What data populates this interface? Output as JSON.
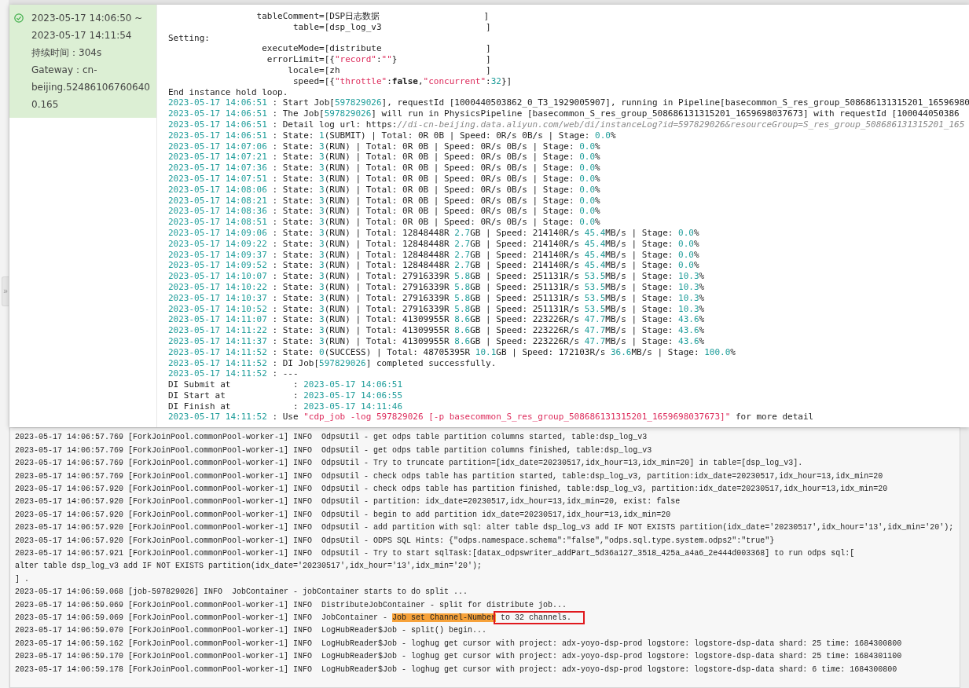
{
  "sidebar_toggle": "»",
  "run_card": {
    "succeeded": true,
    "time_range": "2023-05-17 14:06:50 ~ 2023-05-17 14:11:54",
    "duration": "持续时间：304s",
    "gateway": "Gateway：cn-beijing.524861067606400.165"
  },
  "run_log": [
    {
      "segments": [
        {
          "kind": "plain",
          "text": "                 tableComment=[DSP日志数据                    ]"
        }
      ]
    },
    {
      "segments": [
        {
          "kind": "plain",
          "text": "                        table=[dsp_log_v3                    ]"
        }
      ]
    },
    {
      "segments": [
        {
          "kind": "plain",
          "text": "Setting:"
        }
      ]
    },
    {
      "segments": [
        {
          "kind": "plain",
          "text": "                  executeMode=[distribute                    ]"
        }
      ]
    },
    {
      "segments": [
        {
          "kind": "plain",
          "text": "                   errorLimit=[{"
        },
        {
          "kind": "string",
          "text": "\"record\""
        },
        {
          "kind": "plain",
          "text": ":"
        },
        {
          "kind": "string",
          "text": "\"\""
        },
        {
          "kind": "plain",
          "text": "}                 ]"
        }
      ]
    },
    {
      "segments": [
        {
          "kind": "plain",
          "text": "                       locale=[zh                            ]"
        }
      ]
    },
    {
      "segments": [
        {
          "kind": "plain",
          "text": "                        speed=[{"
        },
        {
          "kind": "string",
          "text": "\"throttle\""
        },
        {
          "kind": "plain",
          "text": ":"
        },
        {
          "kind": "bold",
          "text": "false"
        },
        {
          "kind": "plain",
          "text": ","
        },
        {
          "kind": "string",
          "text": "\"concurrent\""
        },
        {
          "kind": "plain",
          "text": ":"
        },
        {
          "kind": "number",
          "text": "32"
        },
        {
          "kind": "plain",
          "text": "}]"
        }
      ]
    },
    {
      "segments": [
        {
          "kind": "plain",
          "text": "End instance hold loop."
        }
      ]
    },
    {
      "segments": [
        {
          "kind": "number",
          "text": "2023-05-17 14:06:51"
        },
        {
          "kind": "plain",
          "text": " : Start Job["
        },
        {
          "kind": "number",
          "text": "597829026"
        },
        {
          "kind": "plain",
          "text": "], requestId [1000440503862_0_T3_1929005907], running in Pipeline[basecommon_S_res_group_508686131315201_16596980"
        }
      ]
    },
    {
      "segments": [
        {
          "kind": "number",
          "text": "2023-05-17 14:06:51"
        },
        {
          "kind": "plain",
          "text": " : The Job["
        },
        {
          "kind": "number",
          "text": "597829026"
        },
        {
          "kind": "plain",
          "text": "] will run in PhysicsPipeline [basecommon_S_res_group_508686131315201_1659698037673] with requestId [100044050386"
        }
      ]
    },
    {
      "segments": [
        {
          "kind": "number",
          "text": "2023-05-17 14:06:51"
        },
        {
          "kind": "plain",
          "text": " : Detail log url: https:"
        },
        {
          "kind": "link",
          "text": "//di-cn-beijing.data.aliyun.com/web/di/instanceLog?id=597829026&resourceGroup=S_res_group_508686131315201_165"
        }
      ]
    },
    {
      "segments": [
        {
          "kind": "number",
          "text": "2023-05-17 14:06:51"
        },
        {
          "kind": "plain",
          "text": " : State: "
        },
        {
          "kind": "number",
          "text": "1"
        },
        {
          "kind": "plain",
          "text": "(SUBMIT) | Total: 0R 0B | Speed: 0R/s 0B/s | Stage: "
        },
        {
          "kind": "number",
          "text": "0.0"
        },
        {
          "kind": "plain",
          "text": "%"
        }
      ]
    },
    {
      "segments": [
        {
          "kind": "number",
          "text": "2023-05-17 14:07:06"
        },
        {
          "kind": "plain",
          "text": " : State: "
        },
        {
          "kind": "number",
          "text": "3"
        },
        {
          "kind": "plain",
          "text": "(RUN) | Total: 0R 0B | Speed: 0R/s 0B/s | Stage: "
        },
        {
          "kind": "number",
          "text": "0.0"
        },
        {
          "kind": "plain",
          "text": "%"
        }
      ]
    },
    {
      "segments": [
        {
          "kind": "number",
          "text": "2023-05-17 14:07:21"
        },
        {
          "kind": "plain",
          "text": " : State: "
        },
        {
          "kind": "number",
          "text": "3"
        },
        {
          "kind": "plain",
          "text": "(RUN) | Total: 0R 0B | Speed: 0R/s 0B/s | Stage: "
        },
        {
          "kind": "number",
          "text": "0.0"
        },
        {
          "kind": "plain",
          "text": "%"
        }
      ]
    },
    {
      "segments": [
        {
          "kind": "number",
          "text": "2023-05-17 14:07:36"
        },
        {
          "kind": "plain",
          "text": " : State: "
        },
        {
          "kind": "number",
          "text": "3"
        },
        {
          "kind": "plain",
          "text": "(RUN) | Total: 0R 0B | Speed: 0R/s 0B/s | Stage: "
        },
        {
          "kind": "number",
          "text": "0.0"
        },
        {
          "kind": "plain",
          "text": "%"
        }
      ]
    },
    {
      "segments": [
        {
          "kind": "number",
          "text": "2023-05-17 14:07:51"
        },
        {
          "kind": "plain",
          "text": " : State: "
        },
        {
          "kind": "number",
          "text": "3"
        },
        {
          "kind": "plain",
          "text": "(RUN) | Total: 0R 0B | Speed: 0R/s 0B/s | Stage: "
        },
        {
          "kind": "number",
          "text": "0.0"
        },
        {
          "kind": "plain",
          "text": "%"
        }
      ]
    },
    {
      "segments": [
        {
          "kind": "number",
          "text": "2023-05-17 14:08:06"
        },
        {
          "kind": "plain",
          "text": " : State: "
        },
        {
          "kind": "number",
          "text": "3"
        },
        {
          "kind": "plain",
          "text": "(RUN) | Total: 0R 0B | Speed: 0R/s 0B/s | Stage: "
        },
        {
          "kind": "number",
          "text": "0.0"
        },
        {
          "kind": "plain",
          "text": "%"
        }
      ]
    },
    {
      "segments": [
        {
          "kind": "number",
          "text": "2023-05-17 14:08:21"
        },
        {
          "kind": "plain",
          "text": " : State: "
        },
        {
          "kind": "number",
          "text": "3"
        },
        {
          "kind": "plain",
          "text": "(RUN) | Total: 0R 0B | Speed: 0R/s 0B/s | Stage: "
        },
        {
          "kind": "number",
          "text": "0.0"
        },
        {
          "kind": "plain",
          "text": "%"
        }
      ]
    },
    {
      "segments": [
        {
          "kind": "number",
          "text": "2023-05-17 14:08:36"
        },
        {
          "kind": "plain",
          "text": " : State: "
        },
        {
          "kind": "number",
          "text": "3"
        },
        {
          "kind": "plain",
          "text": "(RUN) | Total: 0R 0B | Speed: 0R/s 0B/s | Stage: "
        },
        {
          "kind": "number",
          "text": "0.0"
        },
        {
          "kind": "plain",
          "text": "%"
        }
      ]
    },
    {
      "segments": [
        {
          "kind": "number",
          "text": "2023-05-17 14:08:51"
        },
        {
          "kind": "plain",
          "text": " : State: "
        },
        {
          "kind": "number",
          "text": "3"
        },
        {
          "kind": "plain",
          "text": "(RUN) | Total: 0R 0B | Speed: 0R/s 0B/s | Stage: "
        },
        {
          "kind": "number",
          "text": "0.0"
        },
        {
          "kind": "plain",
          "text": "%"
        }
      ]
    },
    {
      "segments": [
        {
          "kind": "number",
          "text": "2023-05-17 14:09:06"
        },
        {
          "kind": "plain",
          "text": " : State: "
        },
        {
          "kind": "number",
          "text": "3"
        },
        {
          "kind": "plain",
          "text": "(RUN) | Total: 12848448R "
        },
        {
          "kind": "number",
          "text": "2.7"
        },
        {
          "kind": "plain",
          "text": "GB | Speed: 214140R/s "
        },
        {
          "kind": "number",
          "text": "45.4"
        },
        {
          "kind": "plain",
          "text": "MB/s | Stage: "
        },
        {
          "kind": "number",
          "text": "0.0"
        },
        {
          "kind": "plain",
          "text": "%"
        }
      ]
    },
    {
      "segments": [
        {
          "kind": "number",
          "text": "2023-05-17 14:09:22"
        },
        {
          "kind": "plain",
          "text": " : State: "
        },
        {
          "kind": "number",
          "text": "3"
        },
        {
          "kind": "plain",
          "text": "(RUN) | Total: 12848448R "
        },
        {
          "kind": "number",
          "text": "2.7"
        },
        {
          "kind": "plain",
          "text": "GB | Speed: 214140R/s "
        },
        {
          "kind": "number",
          "text": "45.4"
        },
        {
          "kind": "plain",
          "text": "MB/s | Stage: "
        },
        {
          "kind": "number",
          "text": "0.0"
        },
        {
          "kind": "plain",
          "text": "%"
        }
      ]
    },
    {
      "segments": [
        {
          "kind": "number",
          "text": "2023-05-17 14:09:37"
        },
        {
          "kind": "plain",
          "text": " : State: "
        },
        {
          "kind": "number",
          "text": "3"
        },
        {
          "kind": "plain",
          "text": "(RUN) | Total: 12848448R "
        },
        {
          "kind": "number",
          "text": "2.7"
        },
        {
          "kind": "plain",
          "text": "GB | Speed: 214140R/s "
        },
        {
          "kind": "number",
          "text": "45.4"
        },
        {
          "kind": "plain",
          "text": "MB/s | Stage: "
        },
        {
          "kind": "number",
          "text": "0.0"
        },
        {
          "kind": "plain",
          "text": "%"
        }
      ]
    },
    {
      "segments": [
        {
          "kind": "number",
          "text": "2023-05-17 14:09:52"
        },
        {
          "kind": "plain",
          "text": " : State: "
        },
        {
          "kind": "number",
          "text": "3"
        },
        {
          "kind": "plain",
          "text": "(RUN) | Total: 12848448R "
        },
        {
          "kind": "number",
          "text": "2.7"
        },
        {
          "kind": "plain",
          "text": "GB | Speed: 214140R/s "
        },
        {
          "kind": "number",
          "text": "45.4"
        },
        {
          "kind": "plain",
          "text": "MB/s | Stage: "
        },
        {
          "kind": "number",
          "text": "0.0"
        },
        {
          "kind": "plain",
          "text": "%"
        }
      ]
    },
    {
      "segments": [
        {
          "kind": "number",
          "text": "2023-05-17 14:10:07"
        },
        {
          "kind": "plain",
          "text": " : State: "
        },
        {
          "kind": "number",
          "text": "3"
        },
        {
          "kind": "plain",
          "text": "(RUN) | Total: 27916339R "
        },
        {
          "kind": "number",
          "text": "5.8"
        },
        {
          "kind": "plain",
          "text": "GB | Speed: 251131R/s "
        },
        {
          "kind": "number",
          "text": "53.5"
        },
        {
          "kind": "plain",
          "text": "MB/s | Stage: "
        },
        {
          "kind": "number",
          "text": "10.3"
        },
        {
          "kind": "plain",
          "text": "%"
        }
      ]
    },
    {
      "segments": [
        {
          "kind": "number",
          "text": "2023-05-17 14:10:22"
        },
        {
          "kind": "plain",
          "text": " : State: "
        },
        {
          "kind": "number",
          "text": "3"
        },
        {
          "kind": "plain",
          "text": "(RUN) | Total: 27916339R "
        },
        {
          "kind": "number",
          "text": "5.8"
        },
        {
          "kind": "plain",
          "text": "GB | Speed: 251131R/s "
        },
        {
          "kind": "number",
          "text": "53.5"
        },
        {
          "kind": "plain",
          "text": "MB/s | Stage: "
        },
        {
          "kind": "number",
          "text": "10.3"
        },
        {
          "kind": "plain",
          "text": "%"
        }
      ]
    },
    {
      "segments": [
        {
          "kind": "number",
          "text": "2023-05-17 14:10:37"
        },
        {
          "kind": "plain",
          "text": " : State: "
        },
        {
          "kind": "number",
          "text": "3"
        },
        {
          "kind": "plain",
          "text": "(RUN) | Total: 27916339R "
        },
        {
          "kind": "number",
          "text": "5.8"
        },
        {
          "kind": "plain",
          "text": "GB | Speed: 251131R/s "
        },
        {
          "kind": "number",
          "text": "53.5"
        },
        {
          "kind": "plain",
          "text": "MB/s | Stage: "
        },
        {
          "kind": "number",
          "text": "10.3"
        },
        {
          "kind": "plain",
          "text": "%"
        }
      ]
    },
    {
      "segments": [
        {
          "kind": "number",
          "text": "2023-05-17 14:10:52"
        },
        {
          "kind": "plain",
          "text": " : State: "
        },
        {
          "kind": "number",
          "text": "3"
        },
        {
          "kind": "plain",
          "text": "(RUN) | Total: 27916339R "
        },
        {
          "kind": "number",
          "text": "5.8"
        },
        {
          "kind": "plain",
          "text": "GB | Speed: 251131R/s "
        },
        {
          "kind": "number",
          "text": "53.5"
        },
        {
          "kind": "plain",
          "text": "MB/s | Stage: "
        },
        {
          "kind": "number",
          "text": "10.3"
        },
        {
          "kind": "plain",
          "text": "%"
        }
      ]
    },
    {
      "segments": [
        {
          "kind": "number",
          "text": "2023-05-17 14:11:07"
        },
        {
          "kind": "plain",
          "text": " : State: "
        },
        {
          "kind": "number",
          "text": "3"
        },
        {
          "kind": "plain",
          "text": "(RUN) | Total: 41309955R "
        },
        {
          "kind": "number",
          "text": "8.6"
        },
        {
          "kind": "plain",
          "text": "GB | Speed: 223226R/s "
        },
        {
          "kind": "number",
          "text": "47.7"
        },
        {
          "kind": "plain",
          "text": "MB/s | Stage: "
        },
        {
          "kind": "number",
          "text": "43.6"
        },
        {
          "kind": "plain",
          "text": "%"
        }
      ]
    },
    {
      "segments": [
        {
          "kind": "number",
          "text": "2023-05-17 14:11:22"
        },
        {
          "kind": "plain",
          "text": " : State: "
        },
        {
          "kind": "number",
          "text": "3"
        },
        {
          "kind": "plain",
          "text": "(RUN) | Total: 41309955R "
        },
        {
          "kind": "number",
          "text": "8.6"
        },
        {
          "kind": "plain",
          "text": "GB | Speed: 223226R/s "
        },
        {
          "kind": "number",
          "text": "47.7"
        },
        {
          "kind": "plain",
          "text": "MB/s | Stage: "
        },
        {
          "kind": "number",
          "text": "43.6"
        },
        {
          "kind": "plain",
          "text": "%"
        }
      ]
    },
    {
      "segments": [
        {
          "kind": "number",
          "text": "2023-05-17 14:11:37"
        },
        {
          "kind": "plain",
          "text": " : State: "
        },
        {
          "kind": "number",
          "text": "3"
        },
        {
          "kind": "plain",
          "text": "(RUN) | Total: 41309955R "
        },
        {
          "kind": "number",
          "text": "8.6"
        },
        {
          "kind": "plain",
          "text": "GB | Speed: 223226R/s "
        },
        {
          "kind": "number",
          "text": "47.7"
        },
        {
          "kind": "plain",
          "text": "MB/s | Stage: "
        },
        {
          "kind": "number",
          "text": "43.6"
        },
        {
          "kind": "plain",
          "text": "%"
        }
      ]
    },
    {
      "segments": [
        {
          "kind": "number",
          "text": "2023-05-17 14:11:52"
        },
        {
          "kind": "plain",
          "text": " : State: "
        },
        {
          "kind": "number",
          "text": "0"
        },
        {
          "kind": "plain",
          "text": "(SUCCESS) | Total: 48705395R "
        },
        {
          "kind": "number",
          "text": "10.1"
        },
        {
          "kind": "plain",
          "text": "GB | Speed: 172103R/s "
        },
        {
          "kind": "number",
          "text": "36.6"
        },
        {
          "kind": "plain",
          "text": "MB/s | Stage: "
        },
        {
          "kind": "number",
          "text": "100.0"
        },
        {
          "kind": "plain",
          "text": "%"
        }
      ]
    },
    {
      "segments": [
        {
          "kind": "number",
          "text": "2023-05-17 14:11:52"
        },
        {
          "kind": "plain",
          "text": " : DI Job["
        },
        {
          "kind": "number",
          "text": "597829026"
        },
        {
          "kind": "plain",
          "text": "] completed successfully."
        }
      ]
    },
    {
      "segments": [
        {
          "kind": "number",
          "text": "2023-05-17 14:11:52"
        },
        {
          "kind": "plain",
          "text": " : ---"
        }
      ]
    },
    {
      "segments": [
        {
          "kind": "plain",
          "text": "DI Submit at            : "
        },
        {
          "kind": "number",
          "text": "2023-05-17 14:06:51"
        }
      ]
    },
    {
      "segments": [
        {
          "kind": "plain",
          "text": "DI Start at             : "
        },
        {
          "kind": "number",
          "text": "2023-05-17 14:06:55"
        }
      ]
    },
    {
      "segments": [
        {
          "kind": "plain",
          "text": "DI Finish at            : "
        },
        {
          "kind": "number",
          "text": "2023-05-17 14:11:46"
        }
      ]
    },
    {
      "segments": [
        {
          "kind": "number",
          "text": "2023-05-17 14:11:52"
        },
        {
          "kind": "plain",
          "text": " : Use "
        },
        {
          "kind": "string",
          "text": "\"cdp_job -log 597829026 [-p basecommon_S_res_group_508686131315201_1659698037673]\""
        },
        {
          "kind": "plain",
          "text": " for more detail"
        }
      ]
    }
  ],
  "detail_log": [
    {
      "segments": [
        {
          "kind": "plain",
          "text": "2023-05-17 14:06:57.769 [ForkJoinPool.commonPool-worker-1] INFO  OdpsUtil - get odps table partition columns started, table:dsp_log_v3"
        }
      ]
    },
    {
      "segments": [
        {
          "kind": "plain",
          "text": "2023-05-17 14:06:57.769 [ForkJoinPool.commonPool-worker-1] INFO  OdpsUtil - get odps table partition columns finished, table:dsp_log_v3"
        }
      ]
    },
    {
      "segments": [
        {
          "kind": "plain",
          "text": "2023-05-17 14:06:57.769 [ForkJoinPool.commonPool-worker-1] INFO  OdpsUtil - Try to truncate partition=[idx_date=20230517,idx_hour=13,idx_min=20] in table=[dsp_log_v3]."
        }
      ]
    },
    {
      "segments": [
        {
          "kind": "plain",
          "text": "2023-05-17 14:06:57.769 [ForkJoinPool.commonPool-worker-1] INFO  OdpsUtil - check odps table has partition started, table:dsp_log_v3, partition:idx_date=20230517,idx_hour=13,idx_min=20"
        }
      ]
    },
    {
      "segments": [
        {
          "kind": "plain",
          "text": "2023-05-17 14:06:57.920 [ForkJoinPool.commonPool-worker-1] INFO  OdpsUtil - check odps table has partition finished, table:dsp_log_v3, partition:idx_date=20230517,idx_hour=13,idx_min=20"
        }
      ]
    },
    {
      "segments": [
        {
          "kind": "plain",
          "text": "2023-05-17 14:06:57.920 [ForkJoinPool.commonPool-worker-1] INFO  OdpsUtil - partition: idx_date=20230517,idx_hour=13,idx_min=20, exist: false"
        }
      ]
    },
    {
      "segments": [
        {
          "kind": "plain",
          "text": "2023-05-17 14:06:57.920 [ForkJoinPool.commonPool-worker-1] INFO  OdpsUtil - begin to add partition idx_date=20230517,idx_hour=13,idx_min=20"
        }
      ]
    },
    {
      "segments": [
        {
          "kind": "plain",
          "text": "2023-05-17 14:06:57.920 [ForkJoinPool.commonPool-worker-1] INFO  OdpsUtil - add partition with sql: alter table dsp_log_v3 add IF NOT EXISTS partition(idx_date='20230517',idx_hour='13',idx_min='20');"
        }
      ]
    },
    {
      "segments": [
        {
          "kind": "plain",
          "text": "2023-05-17 14:06:57.920 [ForkJoinPool.commonPool-worker-1] INFO  OdpsUtil - ODPS SQL Hints: {\"odps.namespace.schema\":\"false\",\"odps.sql.type.system.odps2\":\"true\"}"
        }
      ]
    },
    {
      "segments": [
        {
          "kind": "plain",
          "text": "2023-05-17 14:06:57.921 [ForkJoinPool.commonPool-worker-1] INFO  OdpsUtil - Try to start sqlTask:[datax_odpswriter_addPart_5d36a127_3518_425a_a4a6_2e444d003368] to run odps sql:["
        }
      ]
    },
    {
      "segments": [
        {
          "kind": "plain",
          "text": "alter table dsp_log_v3 add IF NOT EXISTS partition(idx_date='20230517',idx_hour='13',idx_min='20');"
        }
      ]
    },
    {
      "segments": [
        {
          "kind": "plain",
          "text": "] ."
        }
      ]
    },
    {
      "segments": [
        {
          "kind": "plain",
          "text": "2023-05-17 14:06:59.068 [job-597829026] INFO  JobContainer - jobContainer starts to do split ..."
        }
      ]
    },
    {
      "segments": [
        {
          "kind": "plain",
          "text": "2023-05-17 14:06:59.069 [ForkJoinPool.commonPool-worker-1] INFO  DistributeJobContainer - split for distribute job..."
        }
      ]
    },
    {
      "segments": [
        {
          "kind": "plain",
          "text": "2023-05-17 14:06:59.069 [ForkJoinPool.commonPool-worker-1] INFO  JobContainer - "
        },
        {
          "kind": "highlight",
          "text": "Job set Channel-Number"
        },
        {
          "kind": "boxed",
          "text": " to 32 channels."
        }
      ]
    },
    {
      "segments": [
        {
          "kind": "plain",
          "text": "2023-05-17 14:06:59.070 [ForkJoinPool.commonPool-worker-1] INFO  LogHubReader$Job - split() begin..."
        }
      ]
    },
    {
      "segments": [
        {
          "kind": "plain",
          "text": "2023-05-17 14:06:59.162 [ForkJoinPool.commonPool-worker-1] INFO  LogHubReader$Job - loghug get cursor with project: adx-yoyo-dsp-prod logstore: logstore-dsp-data shard: 25 time: 1684300800"
        }
      ]
    },
    {
      "segments": [
        {
          "kind": "plain",
          "text": "2023-05-17 14:06:59.170 [ForkJoinPool.commonPool-worker-1] INFO  LogHubReader$Job - loghug get cursor with project: adx-yoyo-dsp-prod logstore: logstore-dsp-data shard: 25 time: 1684301100"
        }
      ]
    },
    {
      "segments": [
        {
          "kind": "plain",
          "text": "2023-05-17 14:06:59.178 [ForkJoinPool.commonPool-worker-1] INFO  LogHubReader$Job - loghug get cursor with project: adx-yoyo-dsp-prod logstore: logstore-dsp-data shard: 6 time: 1684300800"
        }
      ]
    }
  ]
}
